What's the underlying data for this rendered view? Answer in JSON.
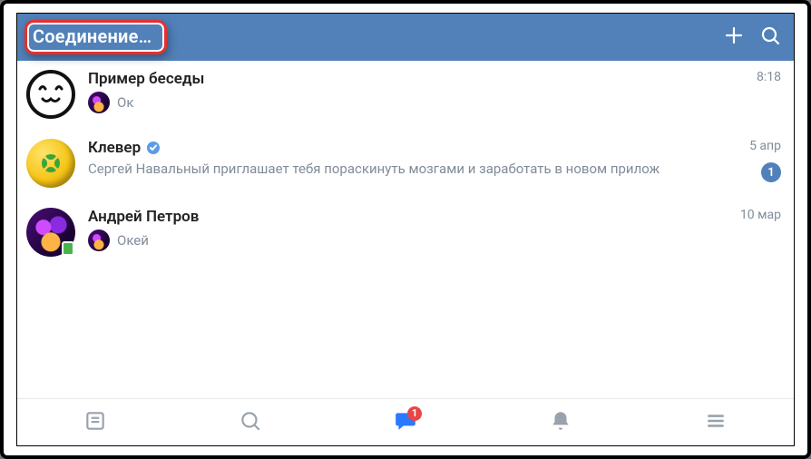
{
  "header": {
    "status_text": "Соединение…"
  },
  "conversations": [
    {
      "name": "Пример беседы",
      "preview": "Ок",
      "time": "8:18",
      "verified": false,
      "has_sender_avatar": true,
      "unread": null,
      "online": false
    },
    {
      "name": "Клевер",
      "preview": "Сергей Навальный приглашает тебя пораскинуть мозгами и заработать в новом прилож",
      "time": "5 апр",
      "verified": true,
      "has_sender_avatar": false,
      "unread": "1",
      "online": false
    },
    {
      "name": "Андрей Петров",
      "preview": "Окей",
      "time": "10 мар",
      "verified": false,
      "has_sender_avatar": true,
      "unread": null,
      "online": true
    }
  ],
  "bottom_nav": {
    "messages_badge": "1"
  },
  "colors": {
    "accent": "#5181b8",
    "highlight_border": "#e53030",
    "text_secondary": "#818c99",
    "badge_red": "#e64646"
  }
}
